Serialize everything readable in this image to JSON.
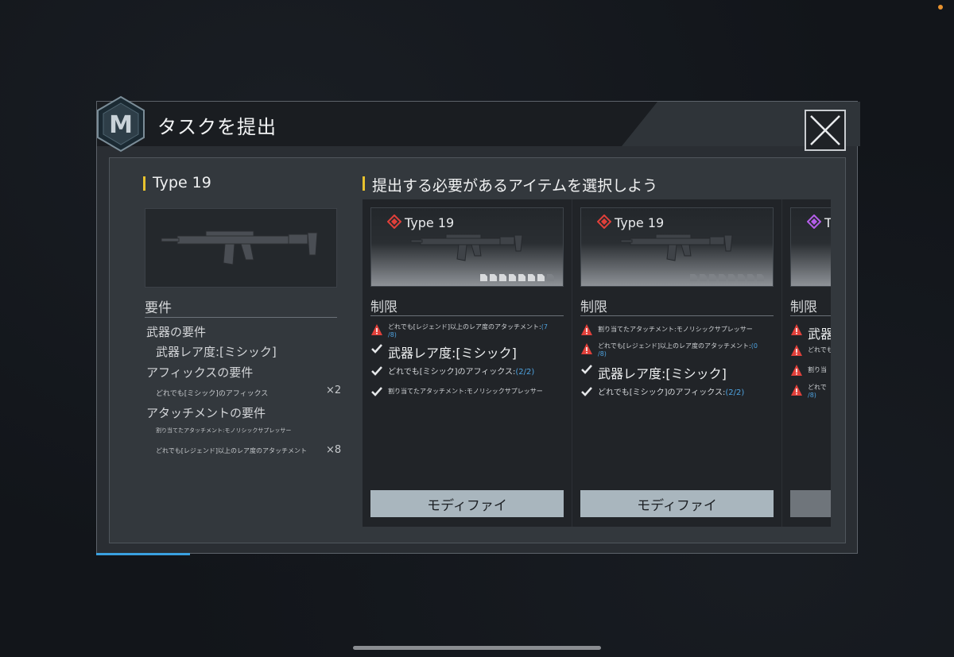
{
  "dialog": {
    "title": "タスクを提出",
    "logo_letter": "M"
  },
  "left": {
    "weapon_name": "Type 19",
    "requirements_title": "要件",
    "weapon_req_title": "武器の要件",
    "weapon_rarity": "武器レア度:[ミシック]",
    "affix_req_title": "アフィックスの要件",
    "affix_req": "どれでも[ミシック]のアフィックス",
    "affix_count": "×2",
    "attach_req_title": "アタッチメントの要件",
    "attach_req_1": "割り当てたアタッチメント:モノリシックサプレッサー",
    "attach_req_2": "どれでも[レジェンド]以上のレア度のアタッチメント",
    "attach_count": "×8"
  },
  "right": {
    "title": "提出する必要があるアイテムを選択しよう"
  },
  "cards": [
    {
      "name": "Type 19",
      "rarity_color": "#e0403a",
      "limit_title": "制限",
      "conditions": [
        {
          "status": "warn",
          "size": "small",
          "text": "どれでも[レジェンド]以上のレア度のアタッチメント:",
          "progress_a": "(7",
          "progress_b": "/8)"
        },
        {
          "status": "ok",
          "size": "big",
          "text": "武器レア度:[ミシック]"
        },
        {
          "status": "ok",
          "size": "med",
          "text": "どれでも[ミシック]のアフィックス:",
          "progress": "(2/2)"
        },
        {
          "status": "ok",
          "size": "small",
          "text": "割り当てたアタッチメント:モノリシックサプレッサー"
        }
      ],
      "button": "モディファイ"
    },
    {
      "name": "Type 19",
      "rarity_color": "#e0403a",
      "limit_title": "制限",
      "conditions": [
        {
          "status": "warn",
          "size": "small",
          "text": "割り当てたアタッチメント:モノリシックサプレッサー"
        },
        {
          "status": "warn",
          "size": "small",
          "text": "どれでも[レジェンド]以上のレア度のアタッチメント:",
          "progress_a": "(0",
          "progress_b": "/8)"
        },
        {
          "status": "ok",
          "size": "big",
          "text": "武器レア度:[ミシック]"
        },
        {
          "status": "ok",
          "size": "med",
          "text": "どれでも[ミシック]のアフィックス:",
          "progress": "(2/2)"
        }
      ],
      "button": "モディファイ"
    },
    {
      "name": "T",
      "rarity_color": "#b45ee8",
      "limit_title": "制限",
      "conditions": [
        {
          "status": "warn",
          "size": "big",
          "text": "武器"
        },
        {
          "status": "warn",
          "size": "small",
          "text": "どれでも"
        },
        {
          "status": "warn",
          "size": "small",
          "text": "割り当"
        },
        {
          "status": "warn",
          "size": "small",
          "text": "どれで",
          "progress_b": "/8)"
        }
      ],
      "button": ""
    }
  ]
}
